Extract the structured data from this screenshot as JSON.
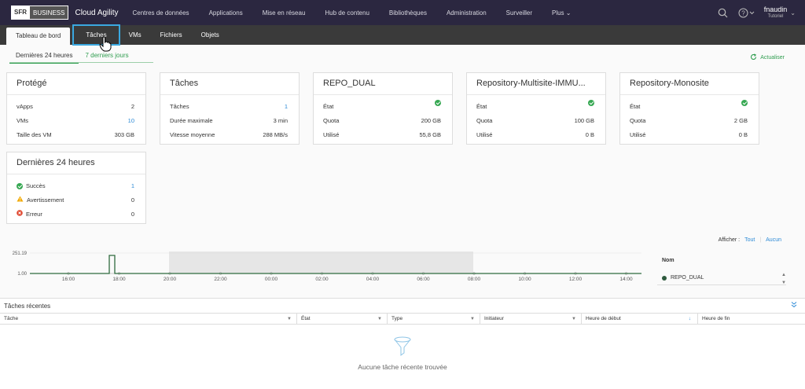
{
  "brand": {
    "sfr": "SFR",
    "business": "BUSINESS",
    "app": "Cloud Agility"
  },
  "nav": [
    "Centres de données",
    "Applications",
    "Mise en réseau",
    "Hub de contenu",
    "Bibliothèques",
    "Administration",
    "Surveiller",
    "Plus"
  ],
  "user": {
    "name": "fnaudin",
    "org": "Tutoriel"
  },
  "subnav": [
    "Tableau de bord",
    "Tâches",
    "VMs",
    "Fichiers",
    "Objets"
  ],
  "time_tabs": [
    "Dernières 24 heures",
    "7 derniers jours"
  ],
  "refresh": "Actualiser",
  "cards": {
    "protected": {
      "title": "Protégé",
      "rows": [
        [
          "vApps",
          "2"
        ],
        [
          "VMs",
          "10"
        ],
        [
          "Taille des VM",
          "303 GB"
        ]
      ]
    },
    "tasks": {
      "title": "Tâches",
      "rows": [
        [
          "Tâches",
          "1"
        ],
        [
          "Durée maximale",
          "3 min"
        ],
        [
          "Vitesse moyenne",
          "288 MB/s"
        ]
      ]
    },
    "repo_dual": {
      "title": "REPO_DUAL",
      "rows": [
        [
          "État",
          ""
        ],
        [
          "Quota",
          "200 GB"
        ],
        [
          "Utilisé",
          "55,8 GB"
        ]
      ]
    },
    "repo_multi": {
      "title": "Repository-Multisite-IMMU...",
      "rows": [
        [
          "État",
          ""
        ],
        [
          "Quota",
          "100 GB"
        ],
        [
          "Utilisé",
          "0 B"
        ]
      ]
    },
    "repo_mono": {
      "title": "Repository-Monosite",
      "rows": [
        [
          "État",
          ""
        ],
        [
          "Quota",
          "2 GB"
        ],
        [
          "Utilisé",
          "0 B"
        ]
      ]
    },
    "last24": {
      "title": "Dernières 24 heures",
      "rows": [
        [
          "Succès",
          "1"
        ],
        [
          "Avertissement",
          "0"
        ],
        [
          "Erreur",
          "0"
        ]
      ]
    }
  },
  "show": {
    "label": "Afficher :",
    "all": "Tout",
    "none": "Aucun"
  },
  "chart_data": {
    "type": "line",
    "y_ticks": [
      "251.19",
      "1.00"
    ],
    "x_ticks": [
      "16:00",
      "18:00",
      "20:00",
      "22:00",
      "00:00",
      "02:00",
      "04:00",
      "06:00",
      "08:00",
      "10:00",
      "12:00",
      "14:00"
    ],
    "series": [
      {
        "name": "REPO_DUAL",
        "color": "#2f6b3f"
      }
    ]
  },
  "legend": {
    "title": "Nom",
    "item": "REPO_DUAL"
  },
  "recent": {
    "title": "Tâches récentes",
    "columns": [
      "Tâche",
      "État",
      "Type",
      "Initiateur",
      "Heure de début",
      "Heure de fin"
    ],
    "empty": "Aucune tâche récente trouvée"
  }
}
